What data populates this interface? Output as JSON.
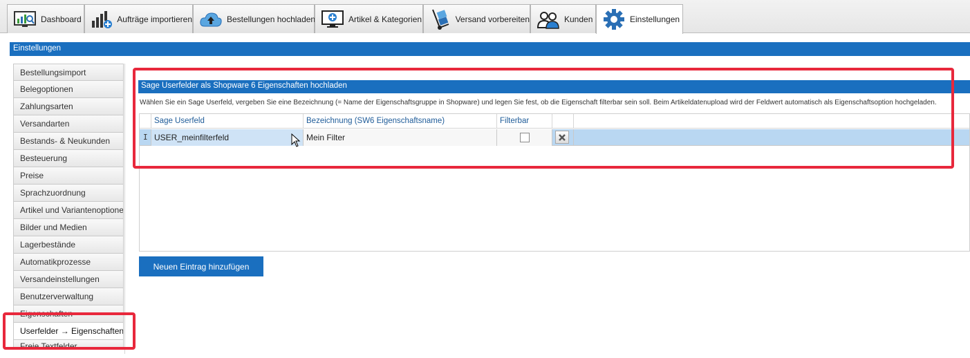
{
  "tabs": [
    {
      "label": "Dashboard",
      "icon": "dashboard-chart-icon"
    },
    {
      "label": "Aufträge importieren",
      "icon": "bar-chart-plus-icon"
    },
    {
      "label": "Bestellungen hochladen",
      "icon": "cloud-upload-icon"
    },
    {
      "label": "Artikel & Kategorien",
      "icon": "monitor-plus-icon"
    },
    {
      "label": "Versand vorbereiten",
      "icon": "hand-truck-icon"
    },
    {
      "label": "Kunden",
      "icon": "users-icon"
    },
    {
      "label": "Einstellungen",
      "icon": "gear-icon",
      "active": true
    }
  ],
  "section_title": "Einstellungen",
  "sidebar": {
    "items": [
      "Bestellungsimport",
      "Belegoptionen",
      "Zahlungsarten",
      "Versandarten",
      "Bestands- & Neukunden",
      "Besteuerung",
      "Preise",
      "Sprachzuordnung",
      "Artikel und Variantenoptionen",
      "Bilder und Medien",
      "Lagerbestände",
      "Automatikprozesse",
      "Versandeinstellungen",
      "Benutzerverwaltung",
      "Eigenschaften",
      "Userfelder → Eigenschaften",
      "Freie Textfelder"
    ],
    "active_index": 15
  },
  "panel": {
    "title": "Sage Userfelder als Shopware 6 Eigenschaften hochladen",
    "description": "Wählen Sie ein Sage Userfeld, vergeben Sie eine Bezeichnung (= Name der Eigenschaftsgruppe in Shopware) und legen Sie fest, ob die Eigenschaft filterbar sein soll. Beim Artikeldatenupload wird der Feldwert automatisch als Eigenschaftsoption hochgeladen.",
    "columns": [
      "Sage Userfeld",
      "Bezeichnung (SW6 Eigenschaftsname)",
      "Filterbar"
    ],
    "rows": [
      {
        "handle": "I",
        "userfeld": "USER_meinfilterfeld",
        "bezeichnung": "Mein Filter",
        "filterbar": false
      }
    ],
    "add_button": "Neuen Eintrag hinzufügen"
  },
  "colors": {
    "accent": "#1a6fbf",
    "highlight": "#e8283c",
    "row_selected": "#b9d7f2"
  }
}
